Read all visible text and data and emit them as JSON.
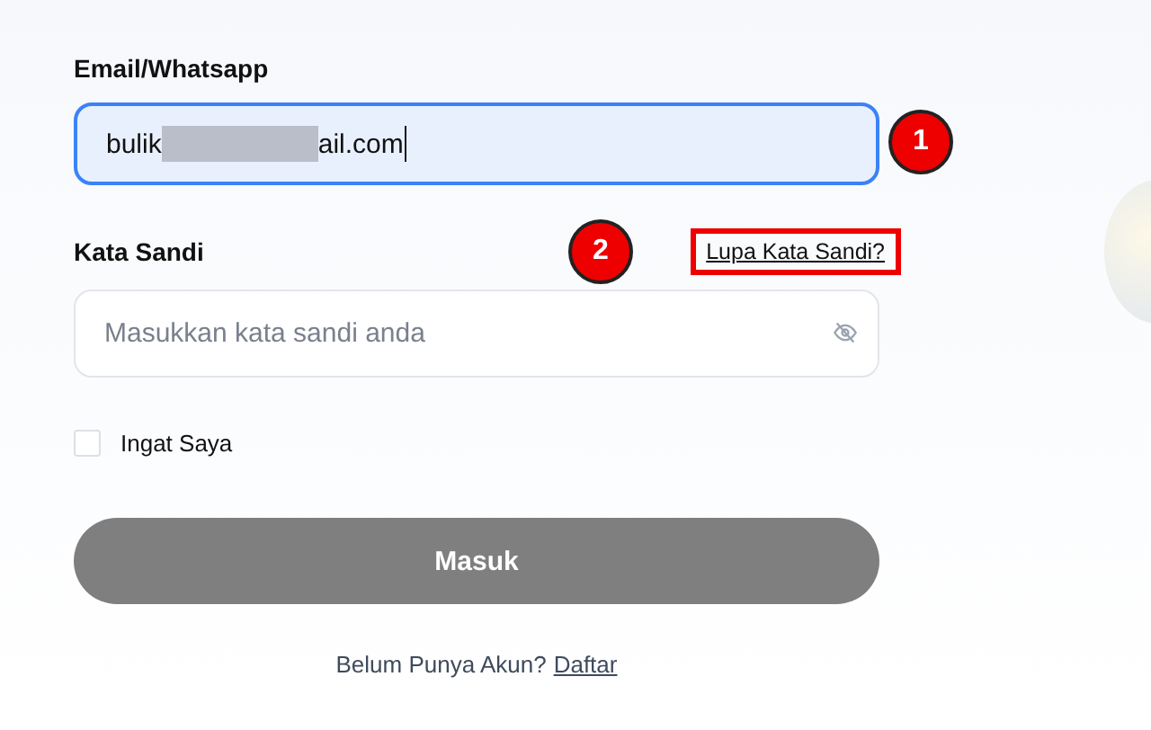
{
  "email": {
    "label": "Email/Whatsapp",
    "value_start": "bulik",
    "redacted": true,
    "value_end": "ail.com",
    "focused": true,
    "marker": "1"
  },
  "password": {
    "label": "Kata Sandi",
    "placeholder": "Masukkan kata sandi anda",
    "forgot_link": "Lupa Kata Sandi?",
    "marker": "2",
    "link_highlighted": true
  },
  "remember": {
    "label": "Ingat Saya",
    "checked": false
  },
  "submit": {
    "label": "Masuk",
    "disabled": true
  },
  "footer": {
    "text": "Belum Punya Akun?",
    "link": "Daftar"
  }
}
